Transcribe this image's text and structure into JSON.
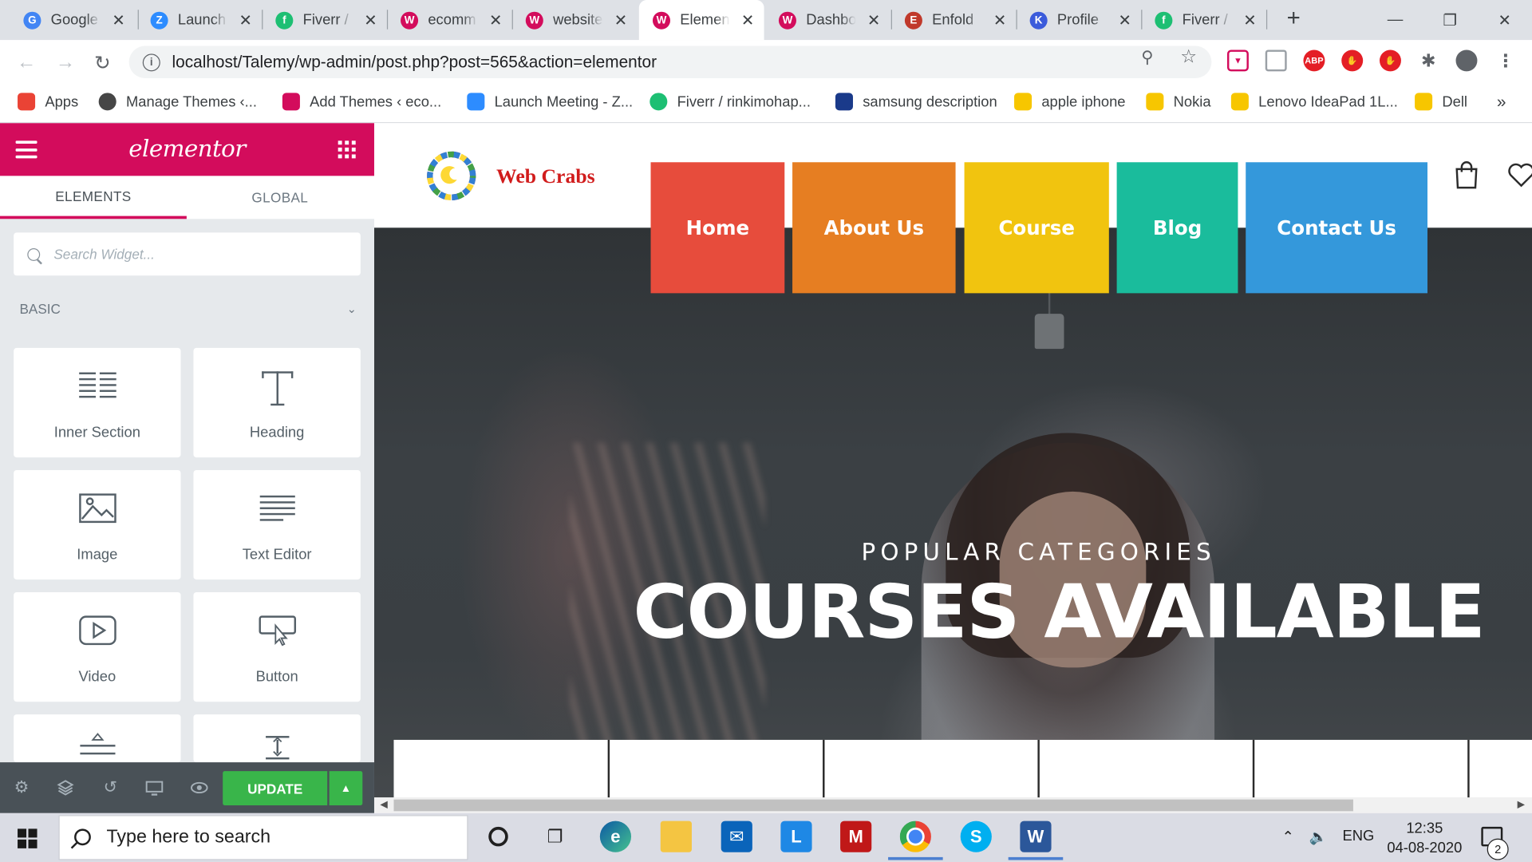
{
  "browser": {
    "tabs": [
      {
        "title": "Google",
        "icon": "google-icon",
        "color": "#4285f4",
        "glyph": "G"
      },
      {
        "title": "Launch",
        "icon": "zoom-icon",
        "color": "#2d8cff",
        "glyph": "Z"
      },
      {
        "title": "Fiverr /",
        "icon": "fiverr-icon",
        "color": "#1dbf73",
        "glyph": "f"
      },
      {
        "title": "ecomm",
        "icon": "woocommerce-icon",
        "color": "#d30c5c",
        "glyph": "W"
      },
      {
        "title": "website",
        "icon": "woocommerce-icon",
        "color": "#d30c5c",
        "glyph": "W"
      },
      {
        "title": "Elemen",
        "icon": "woocommerce-icon",
        "color": "#d30c5c",
        "glyph": "W"
      },
      {
        "title": "Dashbo",
        "icon": "woocommerce-icon",
        "color": "#d30c5c",
        "glyph": "W"
      },
      {
        "title": "Enfold",
        "icon": "enfold-icon",
        "color": "#c0392b",
        "glyph": "E"
      },
      {
        "title": "Profile",
        "icon": "kriesi-icon",
        "color": "#3b5bdb",
        "glyph": "K"
      },
      {
        "title": "Fiverr /",
        "icon": "fiverr-icon",
        "color": "#1dbf73",
        "glyph": "f"
      }
    ],
    "active_tab": 5,
    "url": "localhost/Talemy/wp-admin/post.php?post=565&action=elementor",
    "bookmarks": [
      {
        "label": "Apps",
        "icon": "apps-grid-icon",
        "color": "#ea4335"
      },
      {
        "label": "Manage Themes ‹...",
        "icon": "wordpress-icon",
        "color": "#464646"
      },
      {
        "label": "Add Themes ‹ eco...",
        "icon": "woocommerce-icon",
        "color": "#d30c5c"
      },
      {
        "label": "Launch Meeting - Z...",
        "icon": "zoom-icon",
        "color": "#2d8cff"
      },
      {
        "label": "Fiverr / rinkimohap...",
        "icon": "fiverr-icon",
        "color": "#1dbf73"
      },
      {
        "label": "samsung description",
        "icon": "s-icon",
        "color": "#1a3a8a"
      },
      {
        "label": "apple iphone",
        "icon": "flipkart-icon",
        "color": "#f7c600"
      },
      {
        "label": "Nokia",
        "icon": "flipkart-icon",
        "color": "#f7c600"
      },
      {
        "label": "Lenovo IdeaPad 1L...",
        "icon": "flipkart-icon",
        "color": "#f7c600"
      },
      {
        "label": "Dell",
        "icon": "flipkart-icon",
        "color": "#f7c600"
      }
    ],
    "more_bookmarks": "»"
  },
  "elementor": {
    "logo": "elementor",
    "tabs": [
      "ELEMENTS",
      "GLOBAL"
    ],
    "search_placeholder": "Search Widget...",
    "category": "BASIC",
    "widgets": [
      "Inner Section",
      "Heading",
      "Image",
      "Text Editor",
      "Video",
      "Button"
    ],
    "update_label": "UPDATE",
    "accent": "#d30c5c",
    "update_color": "#39b54a"
  },
  "site": {
    "brand": "Web Crabs",
    "nav": [
      {
        "label": "Home",
        "color": "#e74c3c"
      },
      {
        "label": "About Us",
        "color": "#e67e22"
      },
      {
        "label": "Course",
        "color": "#f1c40f"
      },
      {
        "label": "Blog",
        "color": "#1abc9c"
      },
      {
        "label": "Contact Us",
        "color": "#3498db"
      }
    ],
    "hero_subtitle": "POPULAR CATEGORIES",
    "hero_title": "COURSES AVAILABLE"
  },
  "taskbar": {
    "search_placeholder": "Type here to search",
    "language": "ENG",
    "time": "12:35",
    "date": "04-08-2020",
    "notification_count": "2"
  }
}
